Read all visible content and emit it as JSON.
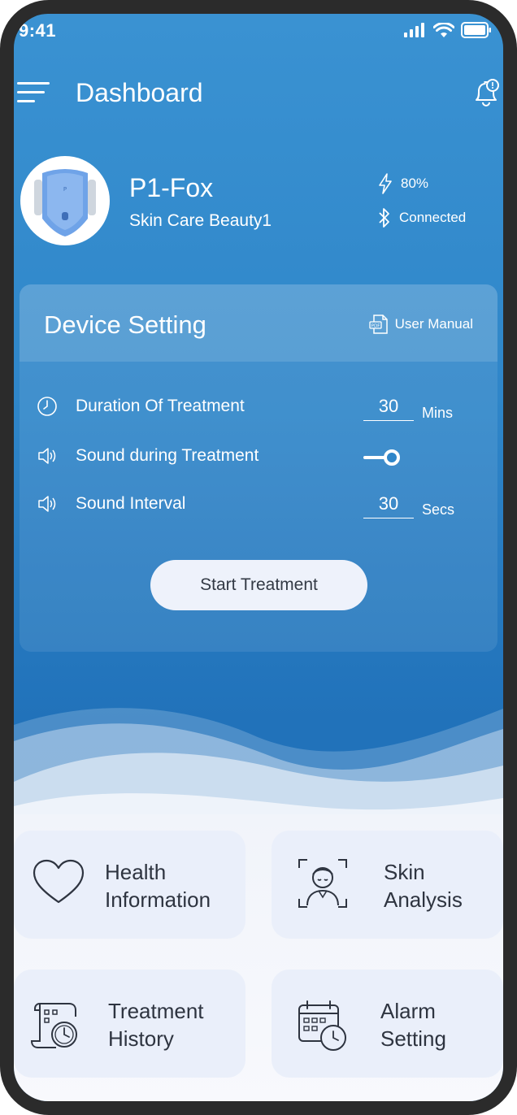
{
  "status_bar": {
    "time": "9:41"
  },
  "header": {
    "title": "Dashboard"
  },
  "device": {
    "name": "P1-Fox",
    "model": "Skin Care Beauty1",
    "battery": "80%",
    "connection": "Connected"
  },
  "device_setting": {
    "title": "Device Setting",
    "manual_label": "User Manual",
    "duration_label": "Duration Of Treatment",
    "duration_value": "30",
    "duration_unit": "Mins",
    "sound_label": "Sound during Treatment",
    "sound_enabled": true,
    "interval_label": "Sound Interval",
    "interval_value": "30",
    "interval_unit": "Secs",
    "start_button": "Start Treatment"
  },
  "tiles": [
    {
      "label": "Health\nInformation",
      "icon": "heart-icon"
    },
    {
      "label": "Skin\nAnalysis",
      "icon": "face-scan-icon"
    },
    {
      "label": "Treatment\nHistory",
      "icon": "history-scroll-icon"
    },
    {
      "label": "Alarm\nSetting",
      "icon": "calendar-clock-icon"
    }
  ],
  "colors": {
    "primary_blue": "#2f86c9",
    "tile_bg": "#eaeffa",
    "button_bg": "#eef2fb",
    "text_dark": "#2e3440"
  }
}
